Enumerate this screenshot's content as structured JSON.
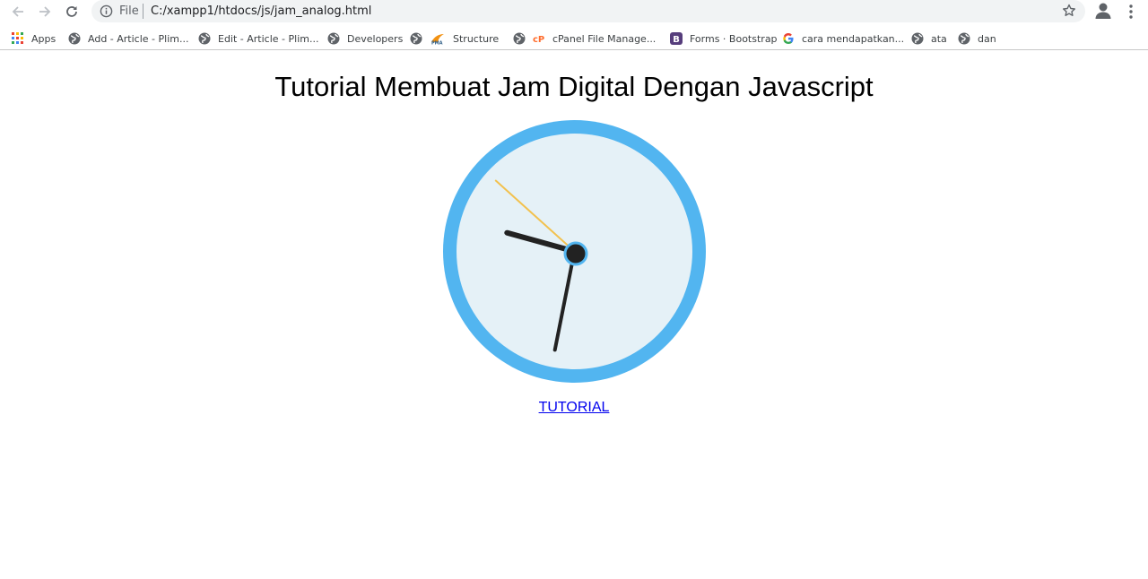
{
  "browser": {
    "address_scheme": "File",
    "address_url": "C:/xampp1/htdocs/js/jam_analog.html"
  },
  "bookmarks": [
    {
      "label": "Apps",
      "icon": "apps-grid-icon"
    },
    {
      "label": "Add - Article - Plim...",
      "icon": "globe-icon"
    },
    {
      "label": "Edit - Article - Plim...",
      "icon": "globe-icon"
    },
    {
      "label": "Developers",
      "icon": "globe-icon"
    },
    {
      "label": "Structure",
      "icon": "phpmyadmin-icon"
    },
    {
      "label": "cPanel File Manage...",
      "icon": "cpanel-icon"
    },
    {
      "label": "Forms · Bootstrap",
      "icon": "bootstrap-icon"
    },
    {
      "label": "cara mendapatkan...",
      "icon": "google-icon"
    },
    {
      "label": "ata",
      "icon": "globe-icon"
    },
    {
      "label": "dan",
      "icon": "globe-icon"
    }
  ],
  "page": {
    "title": "Tutorial Membuat Jam Digital Dengan Javascript",
    "link_label": "TUTORIAL"
  },
  "clock": {
    "hour": 9,
    "minute": 31,
    "second": 52,
    "colors": {
      "ring": "#52b5f0",
      "face": "#e5f1f7",
      "hands": "#222222",
      "second_hand": "#f2c14e",
      "center": "#222222"
    }
  }
}
